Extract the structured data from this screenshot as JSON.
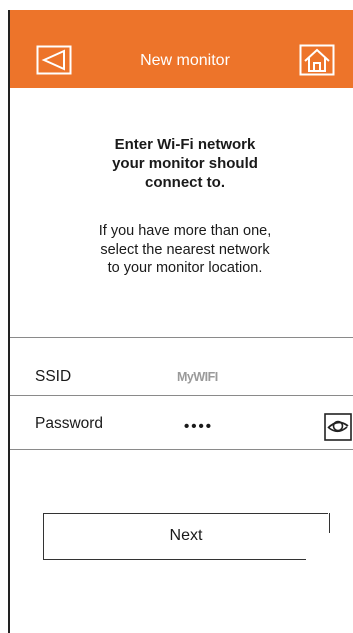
{
  "header": {
    "title": "New monitor",
    "back_icon": "back-icon",
    "home_icon": "home-icon",
    "background_color": "#ed742a"
  },
  "content": {
    "heading": "Enter Wi-Fi network\nyour monitor should\nconnect to.",
    "description": "If you have more than one,\nselect the nearest network\nto your monitor location."
  },
  "form": {
    "ssid_label": "SSID",
    "ssid_value": "MyWIFI",
    "password_label": "Password",
    "password_value": "••••",
    "show_password_icon": "eye-icon"
  },
  "actions": {
    "next_label": "Next"
  }
}
